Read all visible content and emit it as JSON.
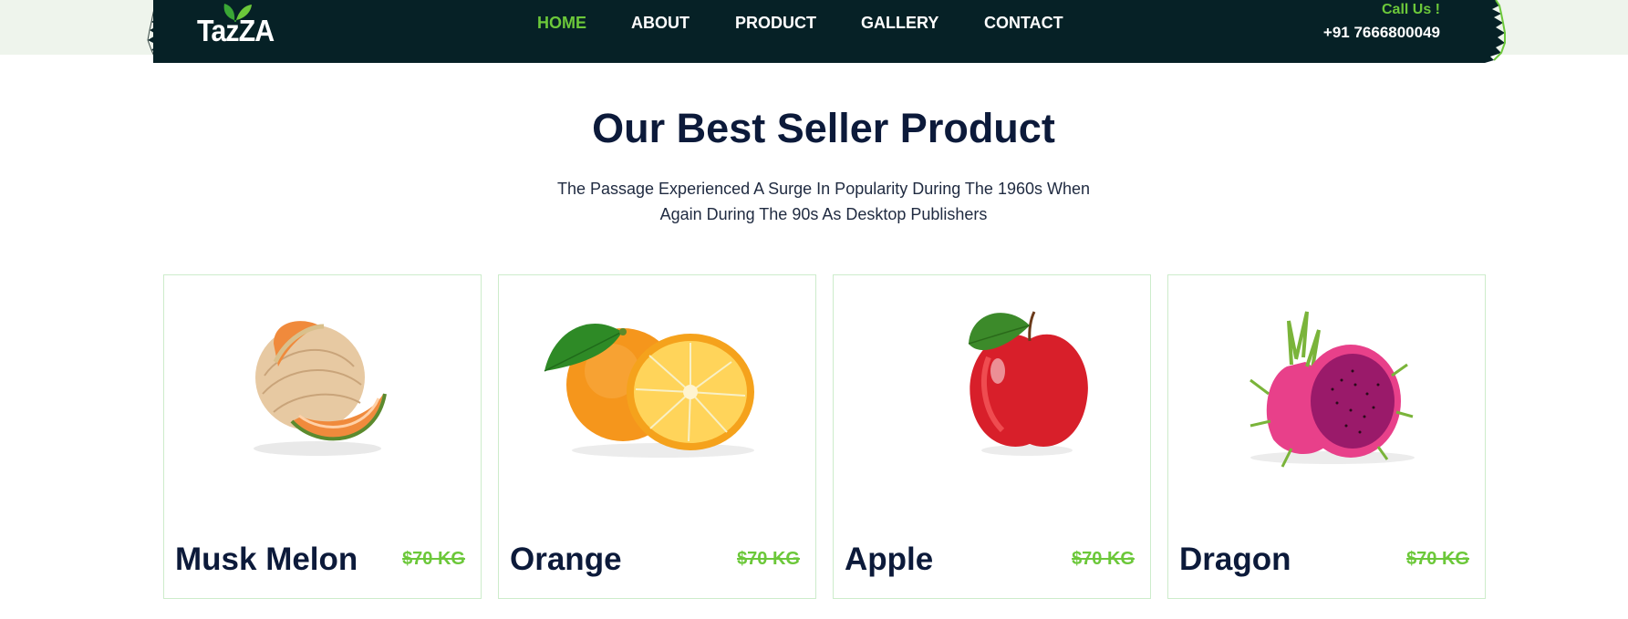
{
  "brand": {
    "name": "TazZA",
    "accent_color": "#6cc83a",
    "nav_bg_color": "#062126",
    "title_color": "#0c1a3a"
  },
  "nav": {
    "items": [
      {
        "label": "HOME",
        "active": true
      },
      {
        "label": "ABOUT",
        "active": false
      },
      {
        "label": "PRODUCT",
        "active": false
      },
      {
        "label": "GALLERY",
        "active": false
      },
      {
        "label": "CONTACT",
        "active": false
      }
    ]
  },
  "contact": {
    "label": "Call Us !",
    "phone": "+91 7666800049"
  },
  "section": {
    "title": "Our Best Seller Product",
    "description_line1": "The Passage Experienced A Surge In Popularity During The 1960s When",
    "description_line2": "Again During The 90s As Desktop Publishers"
  },
  "products": [
    {
      "name": "Musk Melon",
      "price": "$70 KG",
      "image_icon": "musk-melon-image"
    },
    {
      "name": "Orange",
      "price": "$70 KG",
      "image_icon": "orange-image"
    },
    {
      "name": "Apple",
      "price": "$70 KG",
      "image_icon": "apple-image"
    },
    {
      "name": "Dragon",
      "price": "$70 KG",
      "image_icon": "dragon-fruit-image"
    }
  ]
}
